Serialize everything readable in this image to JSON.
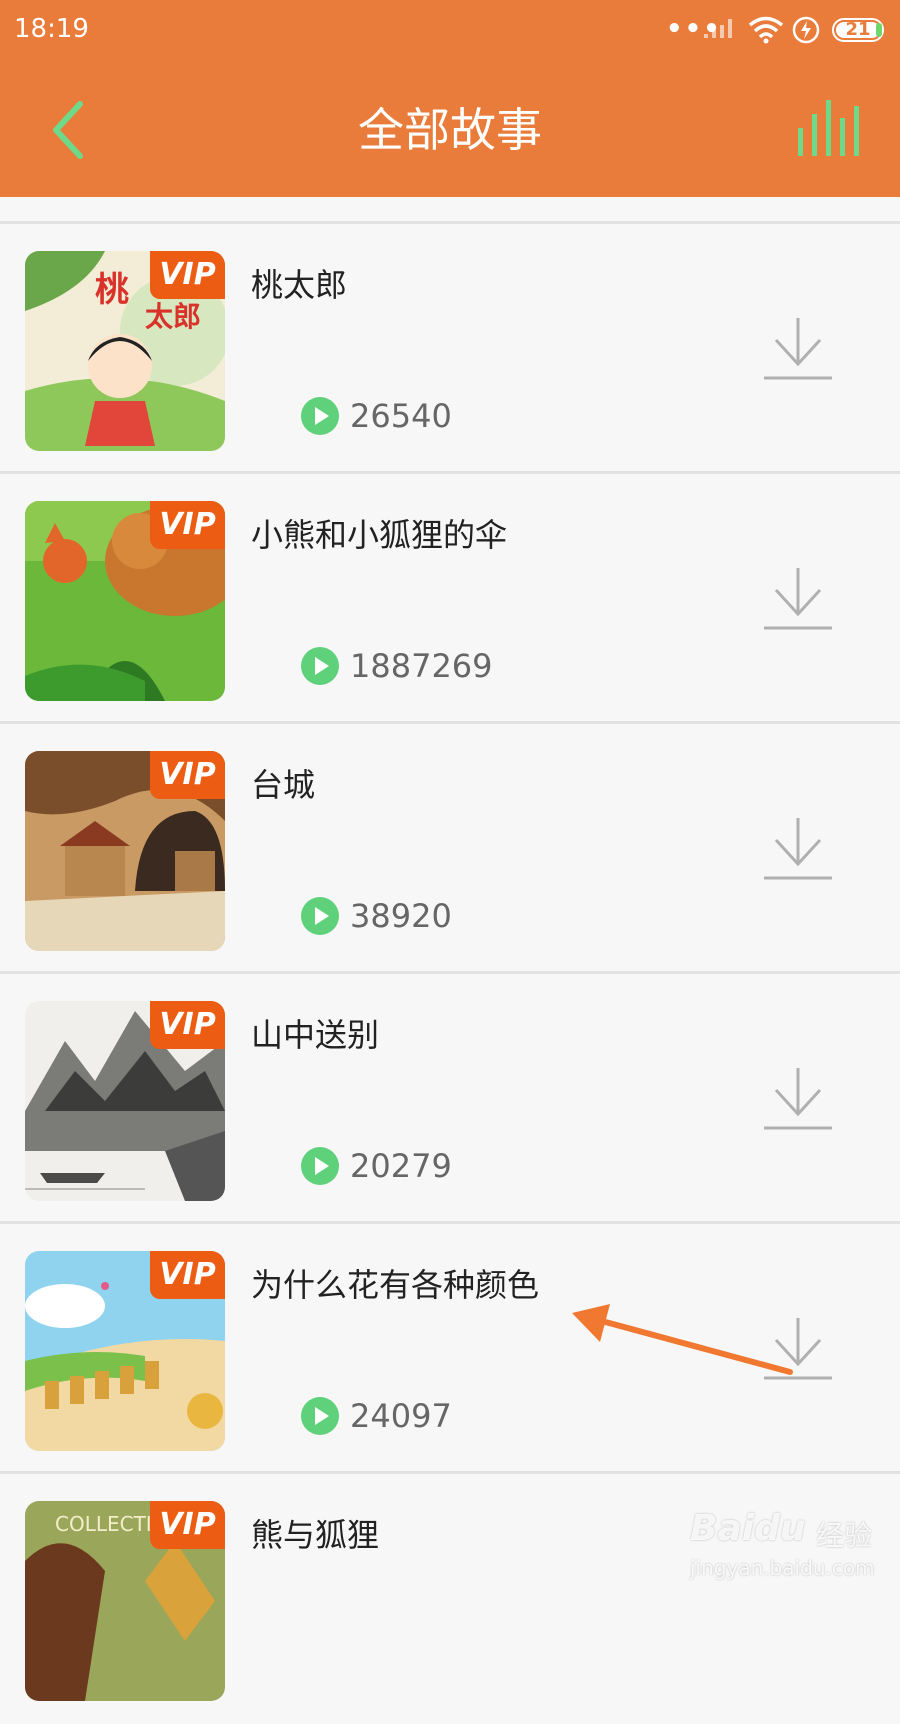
{
  "status_bar": {
    "time": "18:19",
    "battery": "21"
  },
  "app_bar": {
    "title": "全部故事",
    "back_icon": "chevron-left-icon",
    "player_icon": "equalizer-icon"
  },
  "colors": {
    "app_bar": "#e97c3a",
    "vip_badge": "#ec5c13",
    "play_icon": "#5ed17a",
    "annotation_arrow": "#f07830"
  },
  "vip_label": "VIP",
  "stories": [
    {
      "title": "桃太郎",
      "plays": "26540"
    },
    {
      "title": "小熊和小狐狸的伞",
      "plays": "1887269"
    },
    {
      "title": "台城",
      "plays": "38920"
    },
    {
      "title": "山中送别",
      "plays": "20279"
    },
    {
      "title": "为什么花有各种颜色",
      "plays": "24097"
    },
    {
      "title": "熊与狐狸",
      "plays": ""
    }
  ],
  "watermark": {
    "brand": "Baidu",
    "brand_cn": "经验",
    "domain": "jingyan.baidu.com"
  }
}
